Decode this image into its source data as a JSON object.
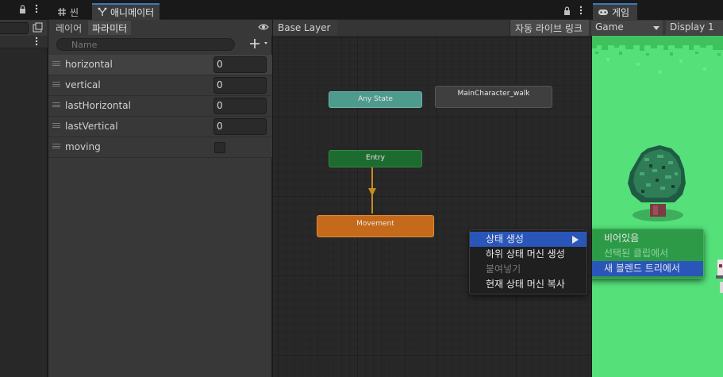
{
  "left_panel": {},
  "animator": {
    "tabs": [
      {
        "label": "씬",
        "icon": "grid-icon"
      },
      {
        "label": "애니메이터",
        "icon": "animator-icon"
      }
    ],
    "subtabs": [
      "레이어",
      "파라미터"
    ],
    "search_placeholder": "Name",
    "parameters": [
      {
        "name": "horizontal",
        "type": "float",
        "value": "0"
      },
      {
        "name": "vertical",
        "type": "float",
        "value": "0"
      },
      {
        "name": "lastHorizontal",
        "type": "float",
        "value": "0"
      },
      {
        "name": "lastVertical",
        "type": "float",
        "value": "0"
      },
      {
        "name": "moving",
        "type": "bool",
        "value": false
      }
    ],
    "breadcrumb": "Base Layer",
    "auto_live_link": "자동 라이브 링크",
    "states": {
      "any_state": "Any State",
      "walk": "MainCharacter_walk",
      "entry": "Entry",
      "movement": "Movement"
    },
    "context_menu": {
      "items": [
        {
          "label": "상태 생성",
          "highlighted": true,
          "submenu": true
        },
        {
          "label": "하위 상태 머신 생성"
        },
        {
          "label": "붙여넣기",
          "disabled": true
        },
        {
          "label": "현재 상태 머신 복사"
        }
      ],
      "submenu": [
        {
          "label": "비어있음"
        },
        {
          "label": "선택된 클립에서",
          "disabled": true
        },
        {
          "label": "새 블렌드 트리에서",
          "highlighted": true
        }
      ]
    },
    "colors": {
      "any_state": "#4e9a8c",
      "entry": "#1e6b30",
      "movement": "#c56a1a",
      "menu_highlight": "#2a56b9",
      "submenu_bg": "#2c9a46"
    }
  },
  "game": {
    "tab_label": "게임",
    "display_mode": "Game",
    "display": "Display 1",
    "grass_color": "#55e07a"
  }
}
